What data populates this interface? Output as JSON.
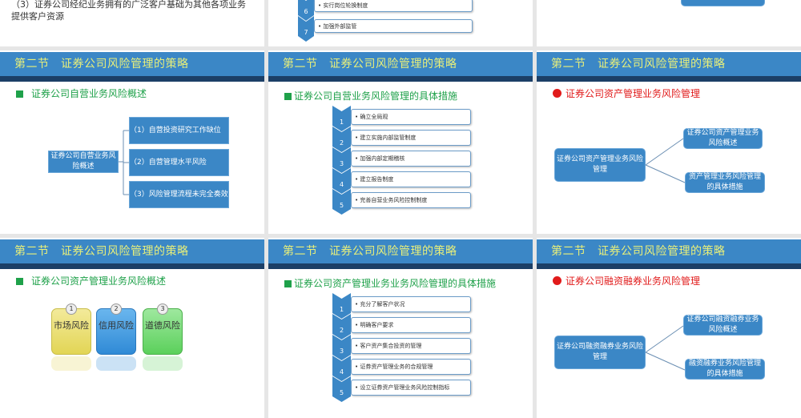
{
  "header": "第二节　证券公司风险管理的策略",
  "top_row": {
    "left_text": "（3）证券公司经纪业务拥有的广泛客户基础为其他各项业务提供客户资源",
    "steps": [
      {
        "n": "6",
        "text": "• 实行岗位轮换制度"
      },
      {
        "n": "7",
        "text": "• 加强外部监管"
      }
    ]
  },
  "slide_a": {
    "heading": "证券公司自营业务风险概述",
    "root": "证券公司自营业务风险概述",
    "items": [
      "（1）自营投资研究工作缺位",
      "（2）自营管理水平风险",
      "（3）风险管理流程未完全奏效"
    ]
  },
  "slide_b": {
    "heading": "证券公司自营业务风险管理的具体措施",
    "steps": [
      {
        "n": "1",
        "text": "• 确立全局观"
      },
      {
        "n": "2",
        "text": "• 建立实施内部监管制度"
      },
      {
        "n": "3",
        "text": "• 加强内部定期稽核"
      },
      {
        "n": "4",
        "text": "• 建立报告制度"
      },
      {
        "n": "5",
        "text": "• 完善自营业务风险控制制度"
      }
    ]
  },
  "slide_c": {
    "heading": "证券公司资产管理业务风险管理",
    "root": "证券公司资产管理业务风险管理",
    "branches": [
      "证券公司资产管理业务风险概述",
      "资产管理业务风险管理的具体措施"
    ]
  },
  "slide_d": {
    "heading": "证券公司资产管理业务风险概述",
    "cards": [
      {
        "n": "1",
        "text": "市场风险",
        "color": "#e8dc6a"
      },
      {
        "n": "2",
        "text": "信用风险",
        "color": "#3f9ae0"
      },
      {
        "n": "3",
        "text": "道德风险",
        "color": "#6fd96f"
      }
    ]
  },
  "slide_e": {
    "heading": "证券公司资产管理业务业务风险管理的具体措施",
    "steps": [
      {
        "n": "1",
        "text": "• 充分了解客户状况"
      },
      {
        "n": "2",
        "text": "• 明确客户要求"
      },
      {
        "n": "3",
        "text": "• 客户资产集合投资的管理"
      },
      {
        "n": "4",
        "text": "• 证券资产管理业务的合规管理"
      },
      {
        "n": "5",
        "text": "• 设立证券资产管理业务风险控制指标"
      }
    ]
  },
  "slide_f": {
    "heading": "证券公司融资融券业务风险管理",
    "root": "证券公司融资融券业务风险管理",
    "branches": [
      "证券公司融资融券业务风险概述",
      "融资融券业务风险管理的具体措施"
    ]
  }
}
